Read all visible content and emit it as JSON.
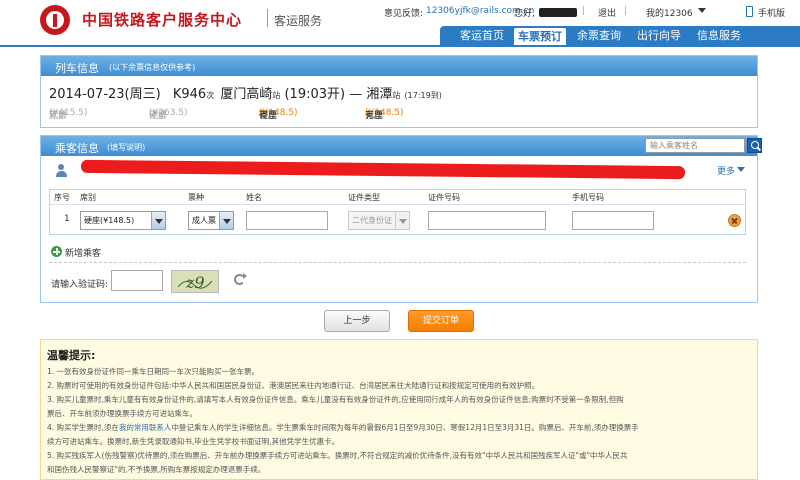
{
  "header": {
    "site_title": "中国铁路客户服务中心",
    "site_subtitle": "客运服务",
    "feedback_label": "意见反馈:",
    "feedback_email": "12306yjfk@rails.com.cn",
    "hello": "您好,",
    "separator": "|",
    "logout": "退出",
    "my_account": "我的12306",
    "mobile": "手机版",
    "nav": [
      "客运首页",
      "车票预订",
      "余票查询",
      "出行向导",
      "信息服务"
    ],
    "nav_active": "车票预订",
    "accent_color": "#2b7bc5",
    "logo_color": "#c8161d"
  },
  "train": {
    "title": "列车信息",
    "hint": "(以下余票信息仅供参考)",
    "date": "2014-07-23(周三)",
    "train_no": "K946",
    "train_suffix": "次",
    "from": "厦门高崎",
    "station_suffix": "站",
    "depart": "(19:03开)",
    "dash": "—",
    "to": "湘潭",
    "arrive": "(17:19到)",
    "seats": [
      {
        "name": "软卧",
        "price": "(¥415.5)",
        "status": "无票"
      },
      {
        "name": "硬卧",
        "price": "(¥263.5)",
        "status": "无票"
      },
      {
        "name": "硬座",
        "price": "(¥148.5)",
        "status": "有票"
      },
      {
        "name": "无座",
        "price": "(¥148.5)",
        "status": "有票"
      }
    ]
  },
  "passenger": {
    "title": "乘客信息",
    "hint": "(填写说明)",
    "search_placeholder": "输入乘客姓名",
    "more": "更多",
    "columns": [
      "序号",
      "席别",
      "票种",
      "姓名",
      "证件类型",
      "证件号码",
      "手机号码"
    ],
    "rows": [
      {
        "index": "1",
        "seat": "硬座(¥148.5)",
        "ticket_type": "成人票",
        "name": "",
        "id_type": "二代身份证",
        "id_no": "",
        "phone": ""
      }
    ],
    "add_label": "新增乘客",
    "captcha_label": "请输入验证码:",
    "captcha_text": "z9"
  },
  "actions": {
    "prev": "上一步",
    "submit": "提交订单",
    "submit_color": "#f77e00"
  },
  "tips": {
    "title": "温馨提示:",
    "lines": [
      "1. 一张有效身份证件同一乘车日期同一车次只能购买一张车票。",
      "2. 购票时可使用的有效身份证件包括:中华人民共和国居民身份证、港澳居民来往内地通行证、台湾居民来往大陆通行证和按规定可使用的有效护照。",
      "3. 购买儿童票时,乘车儿童有有效身份证件的,请填写本人有效身份证件信息。乘车儿童没有有效身份证件的,应使用同行成年人的有效身份证件信息;购票时不受第一条限制,但购",
      "票后、开车前须办理换票手续方可进站乘车。",
      "4. 购买学生票时,须在",
      "我的常用联系人",
      "中登记乘车人的学生详细信息。学生票乘车时间限为每年的暑假6月1日至9月30日、寒假12月1日至3月31日。购票后、开车前,须办理换票手",
      "续方可进站乘车。换票时,新生凭录取通知书,毕业生凭学校书面证明,其他凭学生优惠卡。",
      "5. 购买残疾军人(伤残警察)优待票的,须在购票后、开车前办理换票手续方可进站乘车。换票时,不符合规定的减价优待条件,没有有效\"中华人民共和国残疾军人证\"或\"中华人民共",
      "和国伤残人民警察证\"的,不予换票,所购车票按规定办理退票手续。"
    ]
  }
}
